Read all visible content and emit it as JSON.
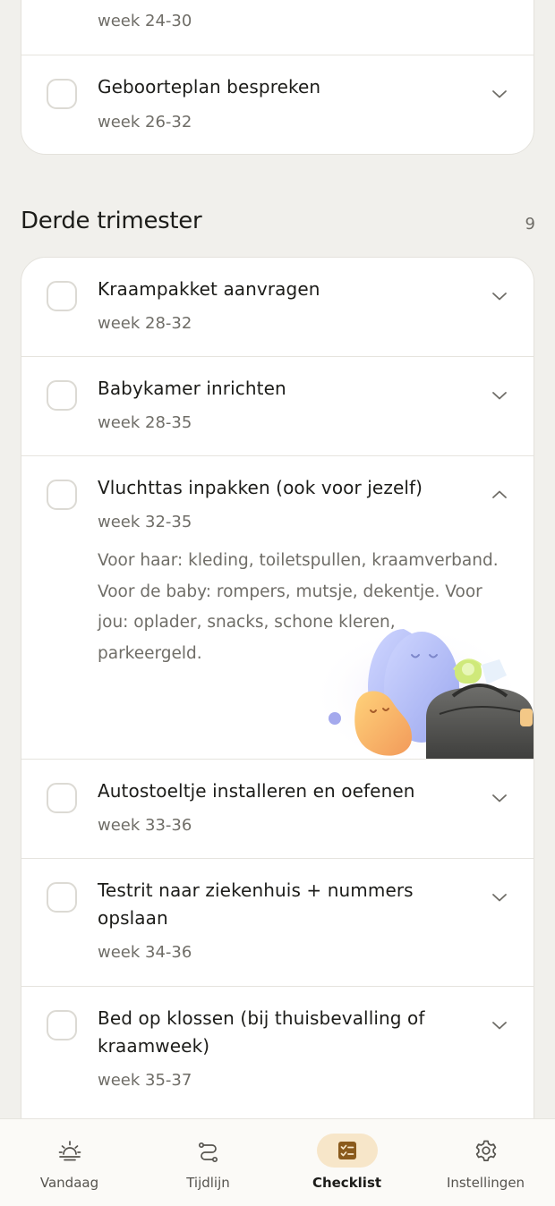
{
  "top_card": {
    "items": [
      {
        "week": "week 24-30"
      },
      {
        "title": "Geboorteplan bespreken",
        "week": "week 26-32"
      }
    ]
  },
  "section": {
    "title": "Derde trimester",
    "count": "9"
  },
  "items": [
    {
      "title": "Kraampakket aanvragen",
      "week": "week 28-32",
      "expanded": false
    },
    {
      "title": "Babykamer inrichten",
      "week": "week 28-35",
      "expanded": false
    },
    {
      "title": "Vluchttas inpakken (ook voor jezelf)",
      "week": "week 32-35",
      "expanded": true,
      "description": "Voor haar: kleding, toiletspullen, kraamverband. Voor de baby: rompers, mutsje, dekentje. Voor jou: oplader, snacks, schone kleren, parkeergeld."
    },
    {
      "title": "Autostoeltje installeren en oefenen",
      "week": "week 33-36",
      "expanded": false
    },
    {
      "title": "Testrit naar ziekenhuis + nummers opslaan",
      "week": "week 34-36",
      "expanded": false
    },
    {
      "title": "Bed op klossen (bij thuisbevalling of kraamweek)",
      "week": "week 35-37",
      "expanded": false
    }
  ],
  "nav": {
    "items": [
      {
        "label": "Vandaag",
        "icon": "sunrise-icon",
        "active": false
      },
      {
        "label": "Tijdlijn",
        "icon": "path-icon",
        "active": false
      },
      {
        "label": "Checklist",
        "icon": "checklist-icon",
        "active": true
      },
      {
        "label": "Instellingen",
        "icon": "gear-icon",
        "active": false
      }
    ]
  },
  "colors": {
    "background": "#f1f0ec",
    "card": "#ffffff",
    "accent": "#8a5a1c",
    "active_pill": "#f7e6c9"
  }
}
